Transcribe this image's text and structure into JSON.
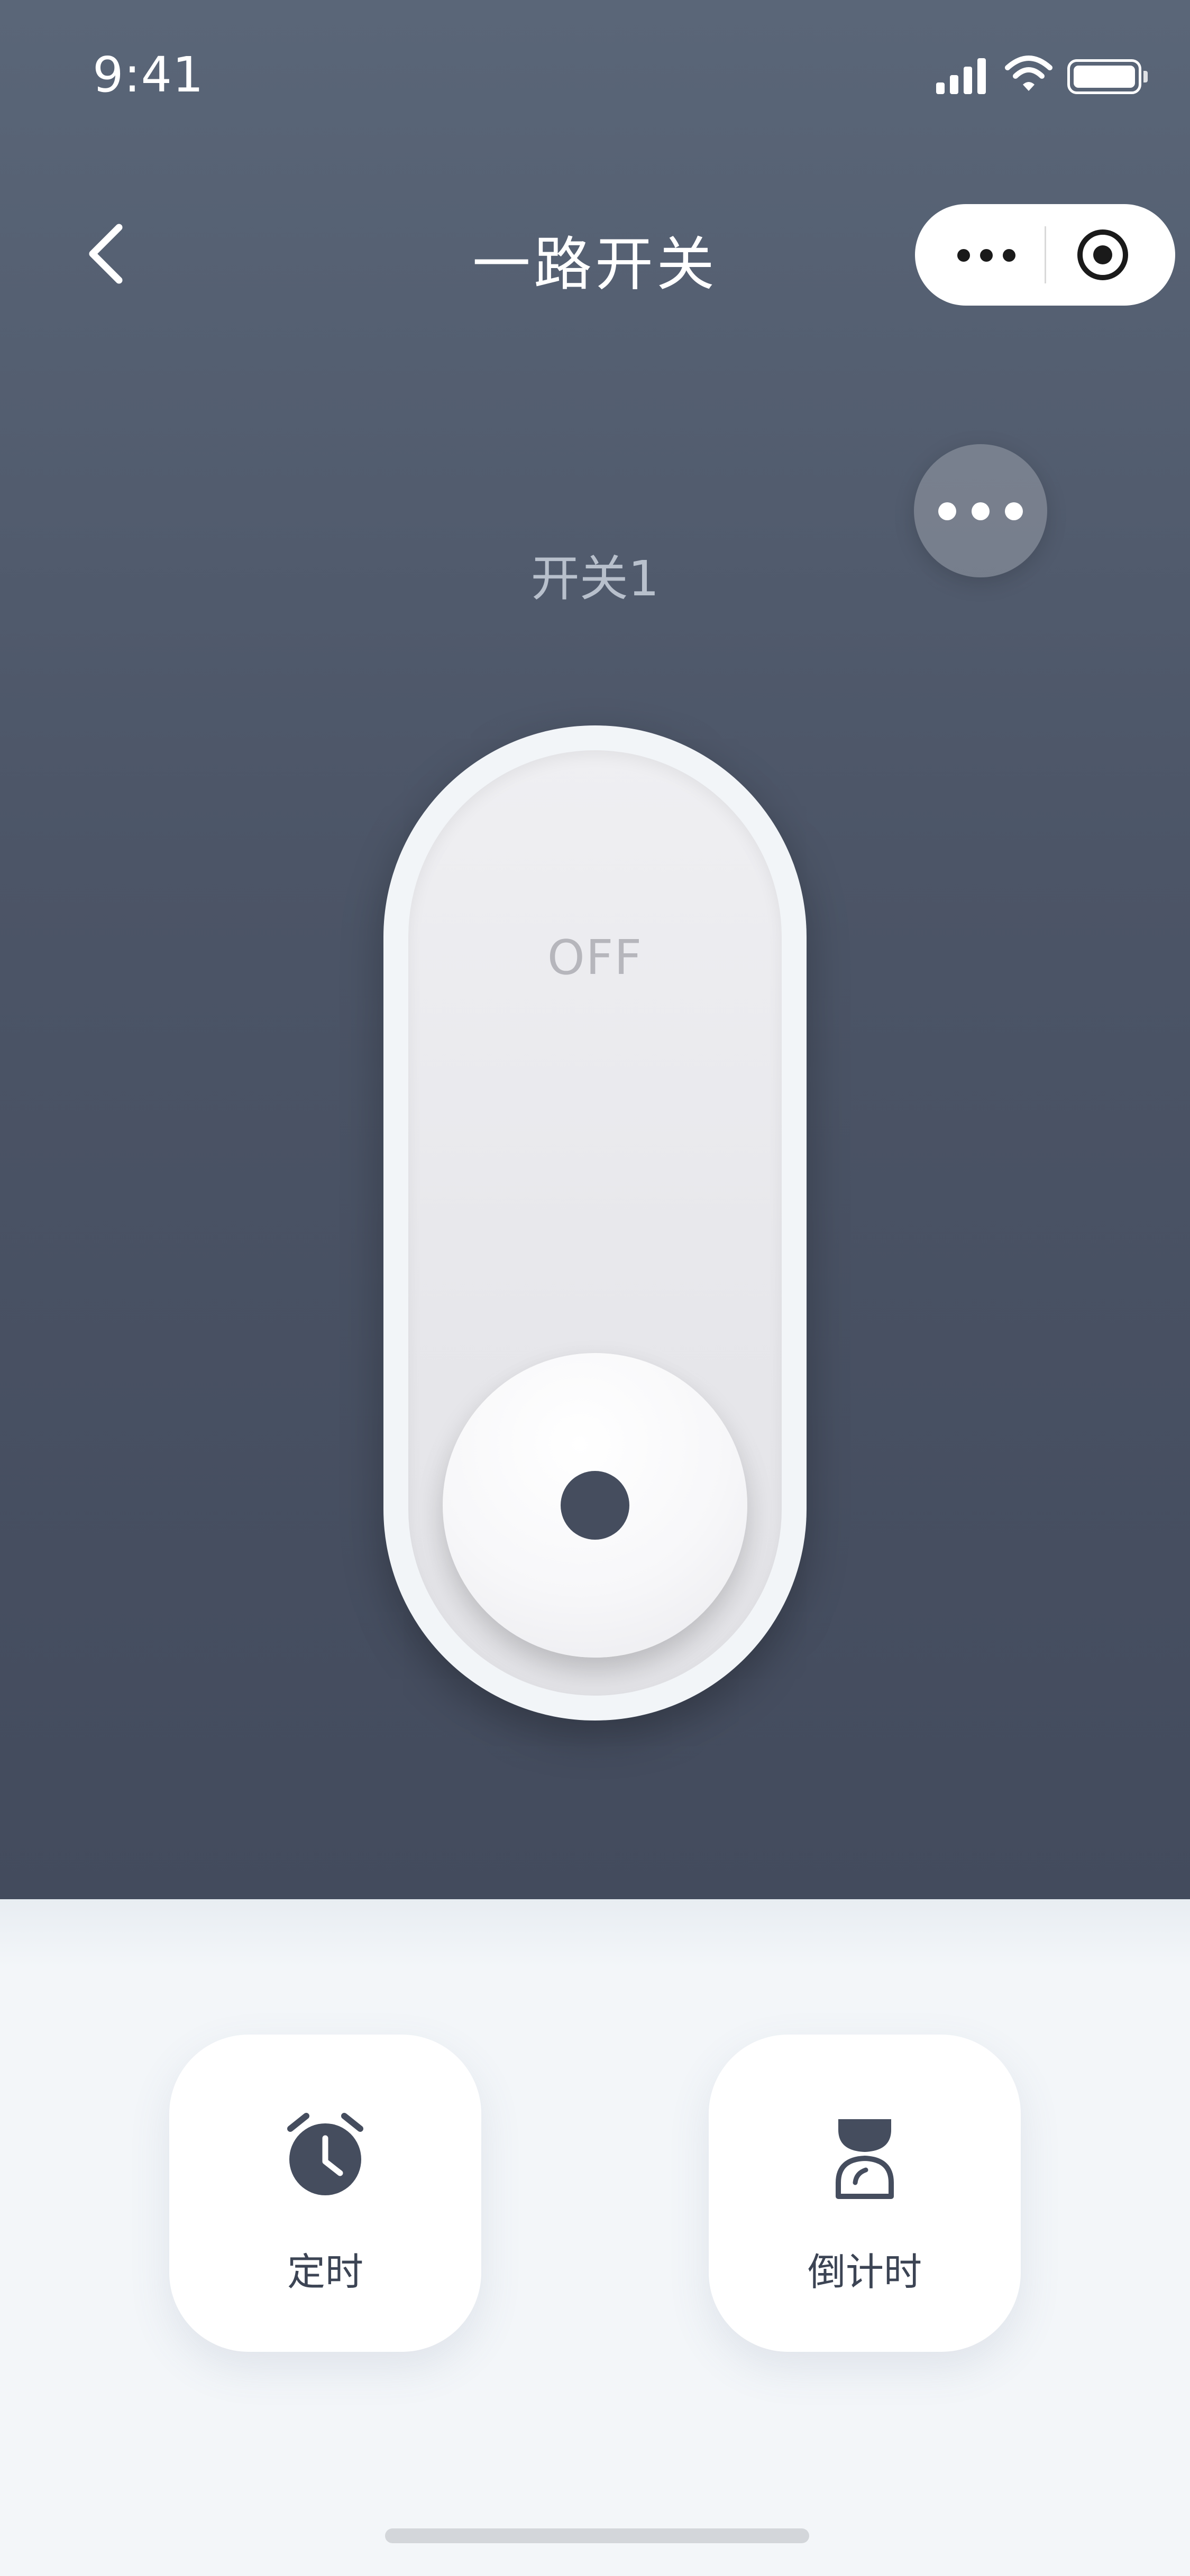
{
  "status_bar": {
    "time": "9:41"
  },
  "nav": {
    "title": "一路开关"
  },
  "device": {
    "switch_name": "开关1",
    "state_label": "OFF"
  },
  "actions": [
    {
      "label": "定时",
      "icon": "alarm-clock-icon"
    },
    {
      "label": "倒计时",
      "icon": "hourglass-icon"
    }
  ],
  "colors": {
    "header_top": "#5a6678",
    "header_bottom": "#434b5d",
    "bottom_bg": "#f3f6f9",
    "knob_dot": "#454d5e",
    "text_dark": "#3c4454"
  }
}
